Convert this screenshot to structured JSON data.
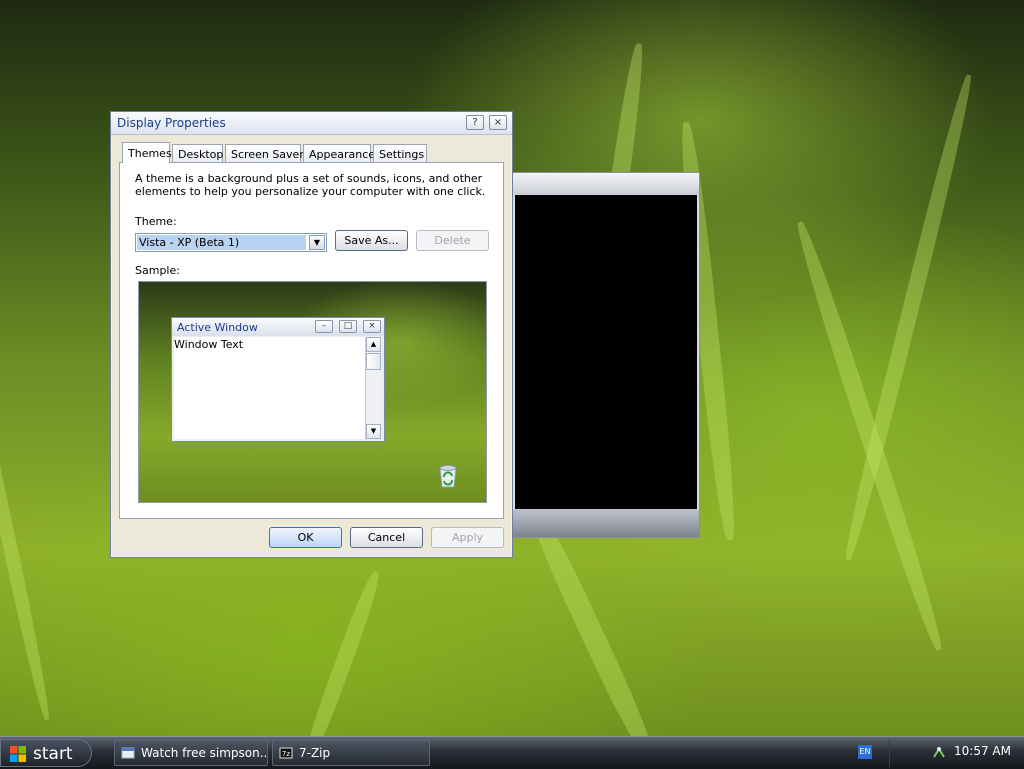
{
  "dialog": {
    "title": "Display Properties",
    "help_btn": "?",
    "close_btn": "×",
    "tabs": [
      "Themes",
      "Desktop",
      "Screen Saver",
      "Appearance",
      "Settings"
    ],
    "active_tab": "Themes",
    "description": "A theme is a background plus a set of sounds, icons, and other elements to help you personalize your computer with one click.",
    "theme_label": "Theme:",
    "theme_value": "Vista - XP (Beta 1)",
    "save_as": "Save As...",
    "delete": "Delete",
    "sample_label": "Sample:",
    "ok": "OK",
    "cancel": "Cancel",
    "apply": "Apply"
  },
  "sample_window": {
    "title": "Active Window",
    "body_text": "Window Text",
    "minimize": "–",
    "maximize": "□",
    "close": "×"
  },
  "taskbar": {
    "start_label": "start",
    "tasks": [
      "Watch free simpson...",
      "7-Zip"
    ],
    "language": "EN",
    "clock": "10:57 AM"
  },
  "colors": {
    "title_text": "#1a3d8a",
    "selected_value_bg": "#b9d3f3",
    "taskbar_bg": "#2a2f37"
  }
}
